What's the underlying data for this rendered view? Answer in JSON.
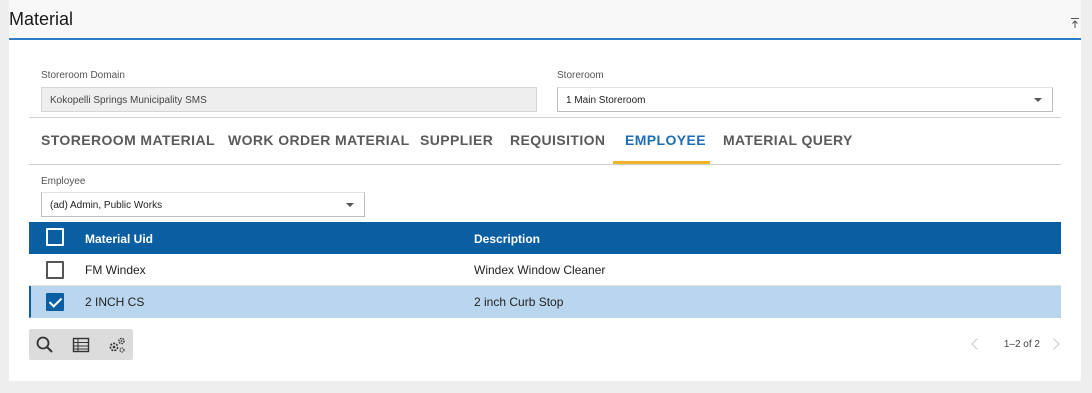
{
  "header": {
    "title": "Material",
    "collapse_icon": "collapse-up-icon"
  },
  "form": {
    "storeroom_domain_label": "Storeroom Domain",
    "storeroom_domain_value": "Kokopelli Springs Municipality SMS",
    "storeroom_label": "Storeroom",
    "storeroom_value": "1 Main Storeroom"
  },
  "tabs": [
    {
      "label": "STOREROOM MATERIAL",
      "active": false
    },
    {
      "label": "WORK ORDER MATERIAL",
      "active": false
    },
    {
      "label": "SUPPLIER",
      "active": false
    },
    {
      "label": "REQUISITION",
      "active": false
    },
    {
      "label": "EMPLOYEE",
      "active": true
    },
    {
      "label": "MATERIAL QUERY",
      "active": false
    }
  ],
  "employee": {
    "label": "Employee",
    "value": "(ad) Admin, Public Works"
  },
  "table": {
    "columns": [
      "Material Uid",
      "Description"
    ],
    "rows": [
      {
        "material_uid": "FM Windex",
        "description": "Windex Window Cleaner",
        "checked": false
      },
      {
        "material_uid": "2 INCH CS",
        "description": "2 inch Curb Stop",
        "checked": true
      }
    ]
  },
  "toolbar": {
    "icons": [
      "search-icon",
      "grid-icon",
      "settings-gears-icon"
    ]
  },
  "pager": {
    "text": "1–2 of 2"
  },
  "colors": {
    "accent": "#0a5fa3",
    "tab_active": "#1e6db5",
    "tab_underline": "#f0b429",
    "selected_row": "#b9d6ee"
  }
}
